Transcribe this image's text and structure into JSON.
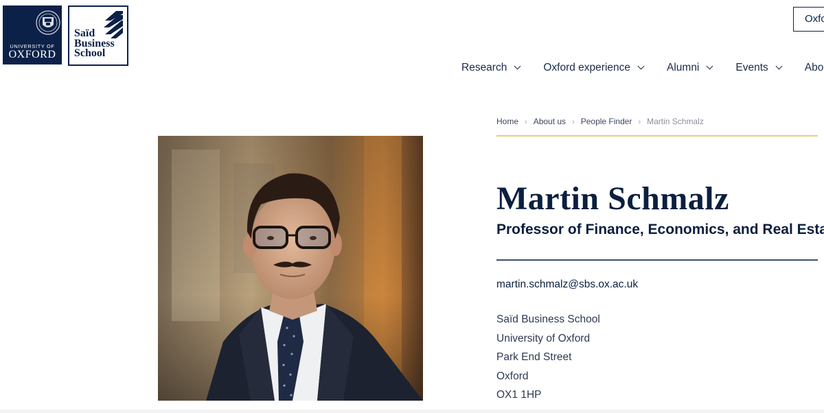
{
  "logos": {
    "oxford": {
      "line1": "UNIVERSITY OF",
      "line2": "OXFORD"
    },
    "said": {
      "line1": "Saïd",
      "line2": "Business",
      "line3": "School"
    }
  },
  "header": {
    "partial_button_label": "Oxford"
  },
  "nav": {
    "items": [
      {
        "label": "Research"
      },
      {
        "label": "Oxford experience"
      },
      {
        "label": "Alumni"
      },
      {
        "label": "Events"
      },
      {
        "label": "About"
      }
    ]
  },
  "breadcrumb": {
    "items": [
      "Home",
      "About us",
      "People Finder",
      "Martin Schmalz"
    ]
  },
  "profile": {
    "name": "Martin Schmalz",
    "title": "Professor of Finance, Economics, and Real Estate",
    "email": "martin.schmalz@sbs.ox.ac.uk",
    "address": [
      "Saïd Business School",
      "University of Oxford",
      "Park End Street",
      "Oxford",
      "OX1 1HP"
    ]
  },
  "colors": {
    "navy": "#0b2148",
    "gold_rule": "#e7cf7a",
    "text": "#0b1f3f"
  }
}
